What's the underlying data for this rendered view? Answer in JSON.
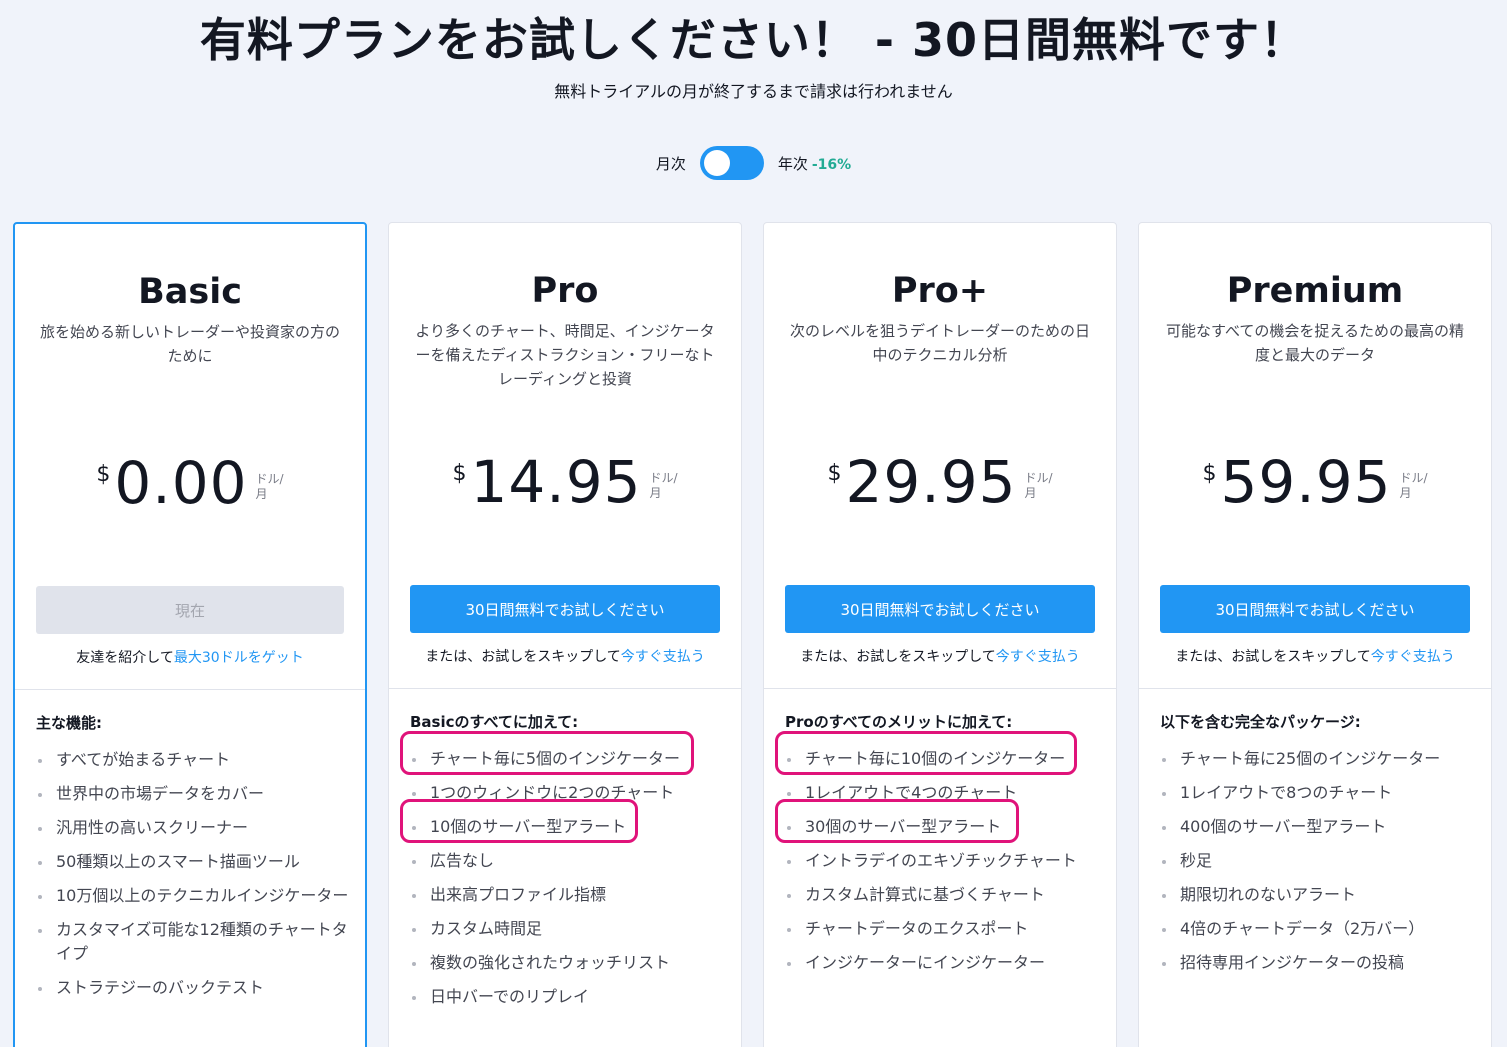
{
  "header": {
    "title": "有料プランをお試しください！ - 30日間無料です！",
    "subtitle": "無料トライアルの月が終了するまで請求は行われません"
  },
  "billing": {
    "monthly_label": "月次",
    "yearly_label": "年次",
    "yearly_discount": "-16%",
    "selected": "monthly"
  },
  "colors": {
    "accent": "#2196f3",
    "discount": "#22ab94",
    "highlight": "#e0137a"
  },
  "plans": [
    {
      "name": "Basic",
      "description": "旅を始める新しいトレーダーや投資家の方のために",
      "currency": "$",
      "price": "0.00",
      "unit": "ドル/ 月",
      "button_label": "現在",
      "button_disabled": true,
      "skip_text": "友達を紹介して",
      "skip_link": "最大30ドルをゲット",
      "features_heading": "主な機能:",
      "features": [
        "すべてが始まるチャート",
        "世界中の市場データをカバー",
        "汎用性の高いスクリーナー",
        "50種類以上のスマート描画ツール",
        "10万個以上のテクニカルインジケーター",
        "カスタマイズ可能な12種類のチャートタイプ",
        "ストラテジーのバックテスト"
      ]
    },
    {
      "name": "Pro",
      "description": "より多くのチャート、時間足、インジケーターを備えたディストラクション・フリーなトレーディングと投資",
      "currency": "$",
      "price": "14.95",
      "unit": "ドル/ 月",
      "button_label": "30日間無料でお試しください",
      "button_disabled": false,
      "skip_text": "または、お試しをスキップして",
      "skip_link": "今すぐ支払う",
      "features_heading": "Basicのすべてに加えて:",
      "features": [
        "チャート毎に5個のインジケーター",
        "1つのウィンドウに2つのチャート",
        "10個のサーバー型アラート",
        "広告なし",
        "出来高プロファイル指標",
        "カスタム時間足",
        "複数の強化されたウォッチリスト",
        "日中バーでのリプレイ"
      ]
    },
    {
      "name": "Pro+",
      "description": "次のレベルを狙うデイトレーダーのための日中のテクニカル分析",
      "currency": "$",
      "price": "29.95",
      "unit": "ドル/ 月",
      "button_label": "30日間無料でお試しください",
      "button_disabled": false,
      "skip_text": "または、お試しをスキップして",
      "skip_link": "今すぐ支払う",
      "features_heading": "Proのすべてのメリットに加えて:",
      "features": [
        "チャート毎に10個のインジケーター",
        "1レイアウトで4つのチャート",
        "30個のサーバー型アラート",
        "イントラデイのエキゾチックチャート",
        "カスタム計算式に基づくチャート",
        "チャートデータのエクスポート",
        "インジケーターにインジケーター"
      ]
    },
    {
      "name": "Premium",
      "description": "可能なすべての機会を捉えるための最高の精度と最大のデータ",
      "currency": "$",
      "price": "59.95",
      "unit": "ドル/ 月",
      "button_label": "30日間無料でお試しください",
      "button_disabled": false,
      "skip_text": "または、お試しをスキップして",
      "skip_link": "今すぐ支払う",
      "features_heading": "以下を含む完全なパッケージ:",
      "features": [
        "チャート毎に25個のインジケーター",
        "1レイアウトで8つのチャート",
        "400個のサーバー型アラート",
        "秒足",
        "期限切れのないアラート",
        "4倍のチャートデータ（2万バー）",
        "招待専用インジケーターの投稿"
      ]
    }
  ]
}
